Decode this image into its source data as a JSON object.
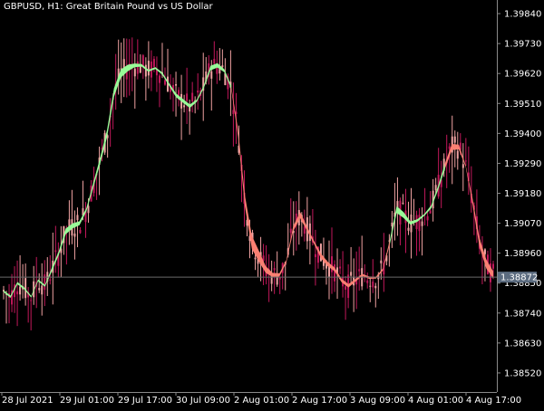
{
  "window": {
    "title": "GBPUSD, H1:  Great Britain Pound vs US Dollar"
  },
  "colors": {
    "background": "#000000",
    "axis": "#8a8a8a",
    "text": "#ffffff",
    "bull_candle": "#f0a2a2",
    "bear_candle": "#c2185b",
    "bull_band": "#98fb98",
    "bear_band": "#fa8072",
    "price_line": "#6a6a6a",
    "price_tag": "#5b6b7f"
  },
  "chart_data": {
    "type": "line",
    "symbol": "GBPUSD",
    "timeframe": "H1",
    "y_ticks": [
      "1.39840",
      "1.39730",
      "1.39620",
      "1.39510",
      "1.39400",
      "1.39290",
      "1.39180",
      "1.39070",
      "1.38960",
      "1.38850",
      "1.38740",
      "1.38630",
      "1.38520"
    ],
    "ylim": [
      1.3845,
      1.3989
    ],
    "x_ticks": [
      "28 Jul 2021",
      "29 Jul 01:00",
      "29 Jul 17:00",
      "30 Jul 09:00",
      "2 Aug 01:00",
      "2 Aug 17:00",
      "3 Aug 09:00",
      "4 Aug 01:00",
      "4 Aug 17:00"
    ],
    "current_price": "1.38872",
    "series": [
      {
        "values": [
          1.3882,
          1.388,
          1.3885,
          1.3883,
          1.388,
          1.3886,
          1.3884,
          1.389,
          1.3896,
          1.3904,
          1.3906,
          1.3907,
          1.3912,
          1.3921,
          1.393,
          1.394,
          1.3955,
          1.3962,
          1.3964,
          1.3965,
          1.3965,
          1.3963,
          1.3964,
          1.3962,
          1.3958,
          1.3954,
          1.3952,
          1.395,
          1.3952,
          1.3957,
          1.3964,
          1.3965,
          1.3963,
          1.3957,
          1.394,
          1.3915,
          1.39,
          1.3895,
          1.389,
          1.3888,
          1.3888,
          1.3893,
          1.3905,
          1.391,
          1.3905,
          1.39,
          1.3895,
          1.3892,
          1.389,
          1.3886,
          1.3884,
          1.3886,
          1.3888,
          1.3887,
          1.3887,
          1.389,
          1.39,
          1.3912,
          1.391,
          1.3907,
          1.3908,
          1.391,
          1.3913,
          1.392,
          1.3928,
          1.3935,
          1.3935,
          1.3928,
          1.3915,
          1.39,
          1.3892,
          1.3888
        ],
        "bands": [
          {
            "color": "bull",
            "from": 0,
            "to": 33
          },
          {
            "color": "bear",
            "from": 33,
            "to": 56
          },
          {
            "color": "bull",
            "from": 56,
            "to": 64
          },
          {
            "color": "bear",
            "from": 64,
            "to": 72
          }
        ]
      }
    ]
  }
}
